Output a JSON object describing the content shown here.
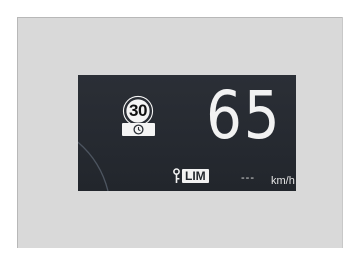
{
  "speed_limit_sign": {
    "value": "30",
    "icon": "clock-icon"
  },
  "current_speed": "65",
  "limiter": {
    "icon": "limiter-key-icon",
    "label": "LIM"
  },
  "set_speed": {
    "value": "---",
    "unit": "km/h"
  },
  "colors": {
    "display_background": "#262a31",
    "text": "#f2f2f2",
    "frame": "#d9d9d9"
  }
}
